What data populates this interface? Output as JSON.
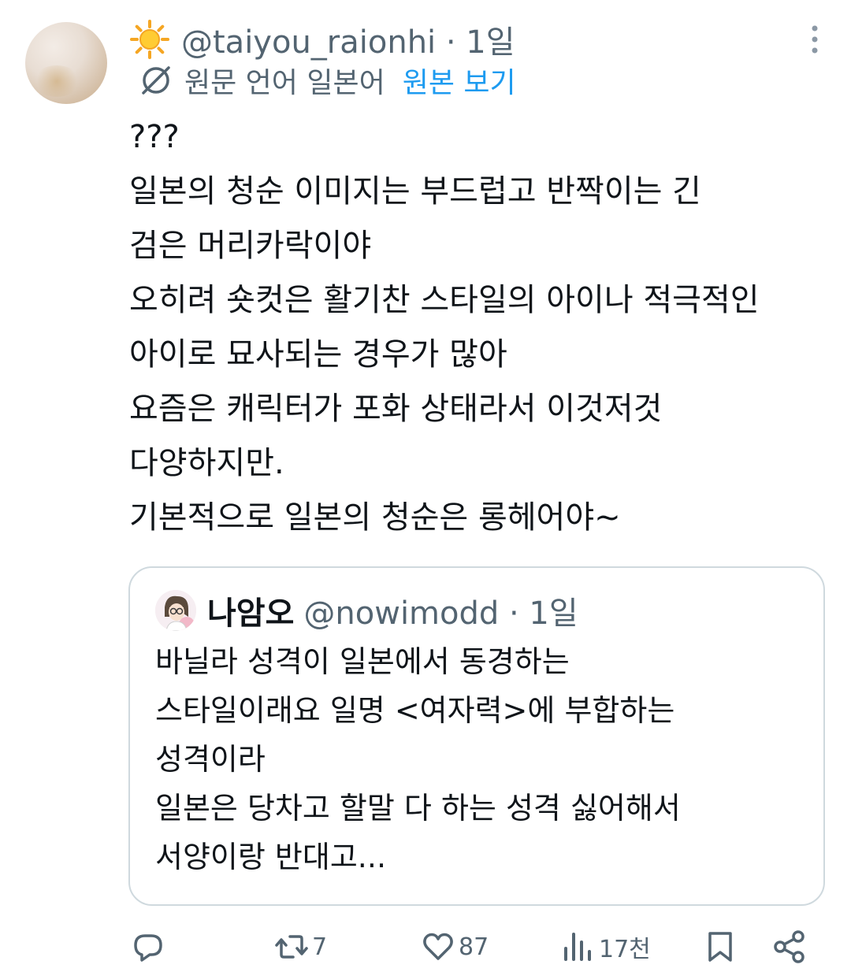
{
  "tweet": {
    "handle_line": "@taiyou_raionhi · 1일",
    "translation": {
      "label": "원문 언어 일본어",
      "view_original": "원본 보기"
    },
    "lines": [
      "???",
      "일본의 청순 이미지는 부드럽고 반짝이는 긴",
      "검은 머리카락이야",
      "오히려 숏컷은 활기찬 스타일의 아이나 적극적인",
      "아이로 묘사되는 경우가 많아",
      "요즘은 캐릭터가 포화 상태라서 이것저것",
      "다양하지만.",
      "기본적으로 일본의 청순은 롱헤어야~"
    ]
  },
  "quoted": {
    "name": "나암오",
    "handle_line": "@nowimodd · 1일",
    "lines": [
      "바닐라 성격이 일본에서 동경하는",
      "스타일이래요 일명 <여자력>에 부합하는",
      "성격이라",
      "일본은 당차고 할말 다 하는 성격 싫어해서",
      "서양이랑 반대고..."
    ]
  },
  "actions": {
    "retweets": "7",
    "likes": "87",
    "views": "17천"
  },
  "icons": {
    "profile_emoji": "sun-icon",
    "more": "more-vertical-icon",
    "translate": "translate-icon",
    "reply": "reply-icon",
    "retweet": "retweet-icon",
    "like": "heart-icon",
    "views": "views-icon",
    "bookmark": "bookmark-icon",
    "share": "share-icon"
  },
  "colors": {
    "link": "#1d9bf0",
    "secondary_text": "#536471",
    "primary_text": "#0f1419",
    "border": "#cfd9de"
  }
}
